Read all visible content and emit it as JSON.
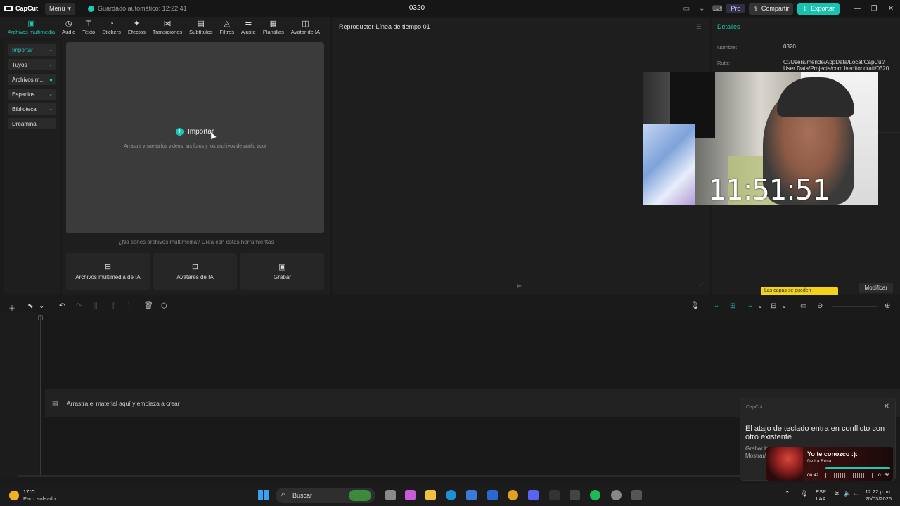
{
  "titlebar": {
    "app_name": "CapCut",
    "menu_label": "Menú",
    "autosave": "Guardado automático: 12:22:41",
    "project_name": "0320",
    "pro_label": "Pro",
    "share_label": "Compartir",
    "export_label": "Exportar"
  },
  "tool_tabs": [
    {
      "label": "Archivos multimedia",
      "icon": "media-icon",
      "active": true
    },
    {
      "label": "Audio",
      "icon": "audio-icon"
    },
    {
      "label": "Texto",
      "icon": "text-icon"
    },
    {
      "label": "Stickers",
      "icon": "sticker-icon"
    },
    {
      "label": "Efectos",
      "icon": "effects-icon"
    },
    {
      "label": "Transiciones",
      "icon": "transitions-icon"
    },
    {
      "label": "Subtítulos",
      "icon": "subtitles-icon"
    },
    {
      "label": "Filtros",
      "icon": "filters-icon"
    },
    {
      "label": "Ajuste",
      "icon": "adjust-icon"
    },
    {
      "label": "Plantillas",
      "icon": "templates-icon"
    },
    {
      "label": "Avatar de IA",
      "icon": "ai-avatar-icon"
    }
  ],
  "sidebar": {
    "items": [
      {
        "label": "Importar"
      },
      {
        "label": "Tuyos"
      },
      {
        "label": "Archivos m..."
      },
      {
        "label": "Espacios"
      },
      {
        "label": "Biblioteca"
      },
      {
        "label": "Dreamina"
      }
    ]
  },
  "media": {
    "import_label": "Importar",
    "drop_hint": "Arrastra y suelta los videos, las fotos y los archivos de audio aquí",
    "no_media": "¿No tienes archivos multimedia? Crea con estas herramientas",
    "ai_tools": [
      {
        "label": "Archivos multimedia de IA"
      },
      {
        "label": "Avatares de IA"
      },
      {
        "label": "Grabar"
      }
    ]
  },
  "player": {
    "title": "Reproductor-Línea de tiempo 01"
  },
  "details": {
    "title": "Detalles",
    "name_label": "Nombre:",
    "name_value": "0320",
    "path_label": "Ruta:",
    "path_value_line1": "C:/Users/mende/AppData/Local/CapCut/",
    "path_value_line2": "User Data/Projects/com.lveditor.draft/0320",
    "tooltip": "Las capas se pueden",
    "modify_label": "Modificar"
  },
  "webcam": {
    "clock": "11:51:51"
  },
  "timeline": {
    "drop_text": "Arrastra el material aquí y empieza a crear"
  },
  "notification": {
    "app": "CapCut",
    "title": "El atajo de teclado entra en conflicto con otro existente",
    "body_line1": "Grabar la",
    "body_line2": "Mostrar/"
  },
  "music": {
    "title": "Yo te conozco :):",
    "artist": "De La Rosa",
    "current": "00:42",
    "total": "01:58"
  },
  "taskbar": {
    "temperature": "17°C",
    "weather": "Parc. soleado",
    "search_label": "Buscar",
    "language_line1": "ESP",
    "language_line2": "LAA",
    "time": "12:22 p. m.",
    "date": "20/03/2026"
  },
  "colors": {
    "accent": "#1fc7b6",
    "background": "#1a1a1a",
    "panel": "#1e1e1e"
  }
}
